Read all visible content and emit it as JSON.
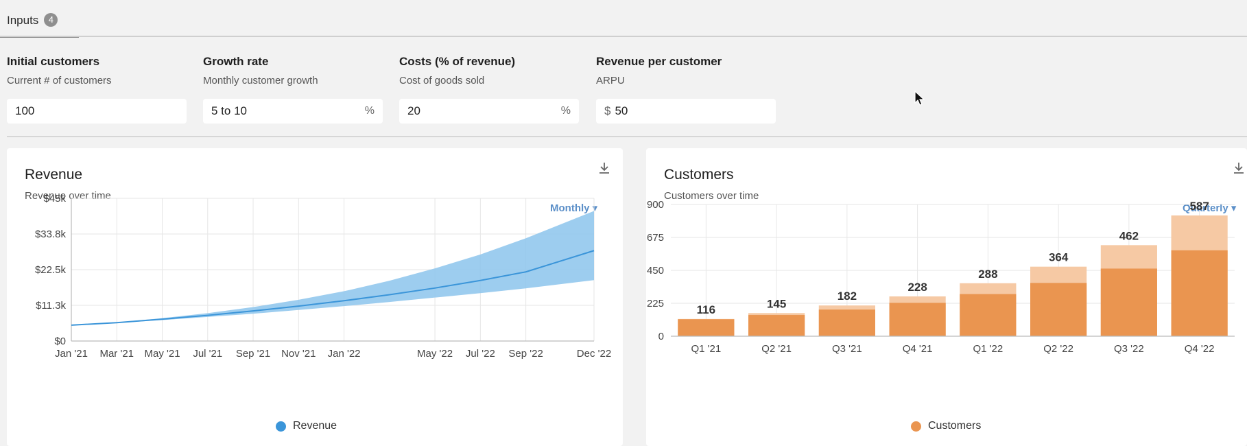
{
  "tabs": {
    "label": "Inputs",
    "count": "4"
  },
  "inputs": [
    {
      "label": "Initial customers",
      "sublabel": "Current # of customers",
      "value": "100",
      "prefix": "",
      "suffix": ""
    },
    {
      "label": "Growth rate",
      "sublabel": "Monthly customer growth",
      "value": "5 to 10",
      "prefix": "",
      "suffix": "%"
    },
    {
      "label": "Costs (% of revenue)",
      "sublabel": "Cost of goods sold",
      "value": "20",
      "prefix": "",
      "suffix": "%"
    },
    {
      "label": "Revenue per customer",
      "sublabel": "ARPU",
      "value": "50",
      "prefix": "$",
      "suffix": ""
    }
  ],
  "revenue_card": {
    "title": "Revenue",
    "subtitle": "Revenue over time",
    "period": "Monthly ▾",
    "legend": "Revenue",
    "color": "#3b95d9",
    "band_color": "#8cc4ec"
  },
  "customers_card": {
    "title": "Customers",
    "subtitle": "Customers over time",
    "period": "Quarterly ▾",
    "legend": "Customers",
    "color": "#ea9550",
    "light_color": "#f6c9a4"
  },
  "chart_data": [
    {
      "type": "area",
      "title": "Revenue",
      "subtitle": "Revenue over time",
      "x_tick_labels": [
        "Jan '21",
        "Mar '21",
        "May '21",
        "Jul '21",
        "Sep '21",
        "Nov '21",
        "Jan '22",
        "May '22",
        "Jul '22",
        "Sep '22",
        "Dec '22"
      ],
      "y_tick_labels": [
        "$0",
        "$11.3k",
        "$22.5k",
        "$33.8k",
        "$45k"
      ],
      "ylim": [
        0,
        45000
      ],
      "x": [
        0,
        2,
        4,
        6,
        8,
        10,
        12,
        14,
        16,
        18,
        20,
        23
      ],
      "series": [
        {
          "name": "Revenue",
          "values": [
            5000,
            5800,
            6900,
            8100,
            9500,
            11000,
            12700,
            14600,
            16700,
            19100,
            21800,
            28500
          ]
        }
      ],
      "band_low": [
        5000,
        5700,
        6600,
        7600,
        8600,
        9800,
        11000,
        12300,
        13700,
        15100,
        16600,
        19200
      ],
      "band_high": [
        5000,
        5900,
        7200,
        8800,
        10700,
        13000,
        15700,
        19000,
        22900,
        27300,
        32400,
        41000
      ],
      "legend": [
        "Revenue"
      ],
      "grid": true,
      "legend_position": "bottom"
    },
    {
      "type": "bar",
      "title": "Customers",
      "subtitle": "Customers over time",
      "categories": [
        "Q1 '21",
        "Q2 '21",
        "Q3 '21",
        "Q4 '21",
        "Q1 '22",
        "Q2 '22",
        "Q3 '22",
        "Q4 '22"
      ],
      "values": [
        116,
        145,
        182,
        228,
        288,
        364,
        462,
        587
      ],
      "upper": [
        118,
        158,
        210,
        272,
        362,
        475,
        622,
        825
      ],
      "data_labels": [
        "116",
        "145",
        "182",
        "228",
        "288",
        "364",
        "462",
        "587"
      ],
      "y_tick_labels": [
        "0",
        "225",
        "450",
        "675",
        "900"
      ],
      "ylim": [
        0,
        900
      ],
      "legend": [
        "Customers"
      ],
      "grid": true,
      "legend_position": "bottom"
    }
  ]
}
